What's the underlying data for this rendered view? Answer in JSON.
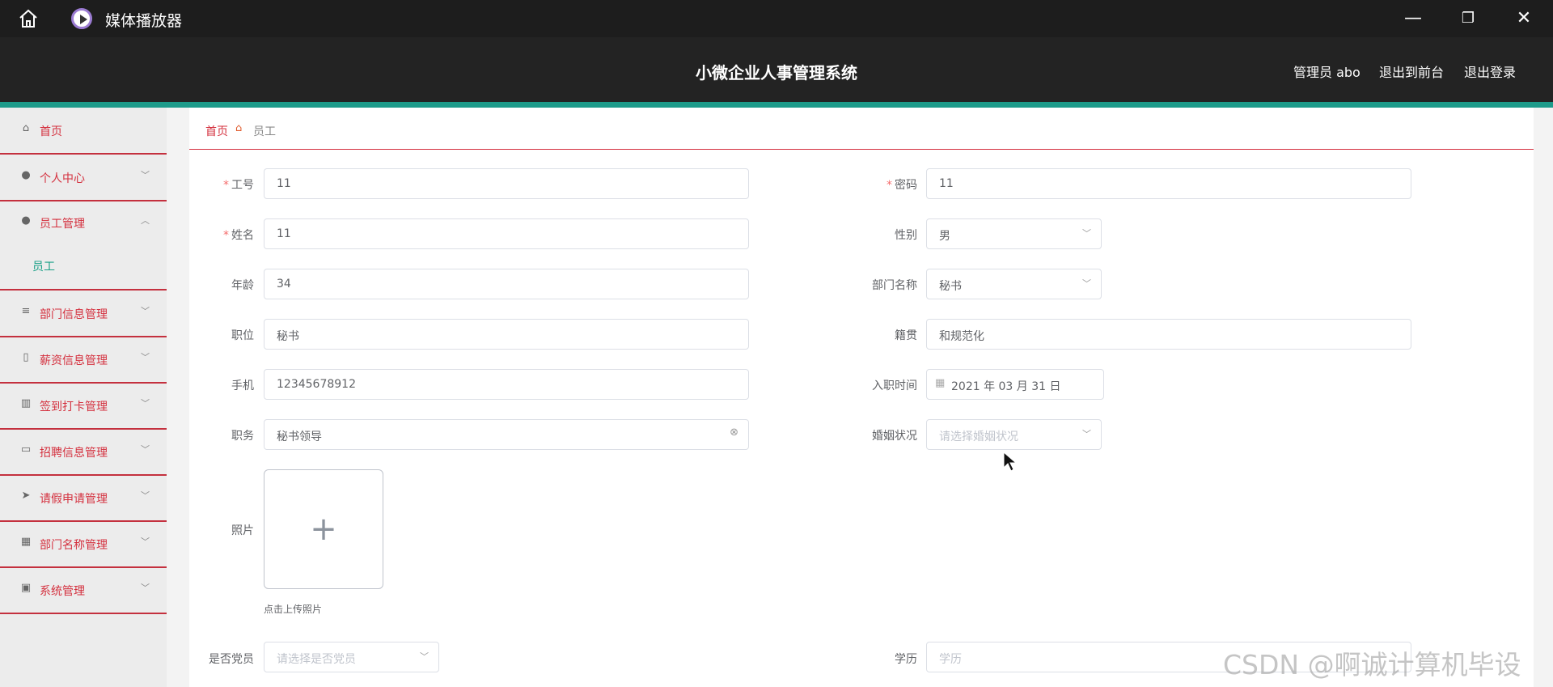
{
  "window": {
    "title": "媒体播放器",
    "controls": [
      "—",
      "❐",
      "✕"
    ]
  },
  "header": {
    "title": "小微企业人事管理系统",
    "links": [
      "管理员 abo",
      "退出到前台",
      "退出登录"
    ],
    "accent_color": "#1d9b8a"
  },
  "sidebar": {
    "items": [
      {
        "label": "首页",
        "icon": "home-icon"
      },
      {
        "label": "个人中心",
        "icon": "user-icon"
      },
      {
        "label": "员工管理",
        "icon": "bulb-icon",
        "sub": [
          "员工"
        ]
      },
      {
        "label": "部门信息管理",
        "icon": "menu-icon"
      },
      {
        "label": "薪资信息管理",
        "icon": "mic-icon"
      },
      {
        "label": "签到打卡管理",
        "icon": "bars-icon"
      },
      {
        "label": "招聘信息管理",
        "icon": "card-icon"
      },
      {
        "label": "请假申请管理",
        "icon": "plane-icon"
      },
      {
        "label": "部门名称管理",
        "icon": "grid-icon"
      },
      {
        "label": "系统管理",
        "icon": "clipboard-icon"
      }
    ]
  },
  "breadcrumb": {
    "home": "首页",
    "current": "员工"
  },
  "form": {
    "gonghao": {
      "label": "工号",
      "value": "11"
    },
    "mima": {
      "label": "密码",
      "value": "11"
    },
    "xingming": {
      "label": "姓名",
      "value": "11"
    },
    "xingbie": {
      "label": "性别",
      "value": "男"
    },
    "nianling": {
      "label": "年龄",
      "value": "34"
    },
    "bumen": {
      "label": "部门名称",
      "value": "秘书"
    },
    "zhiwei": {
      "label": "职位",
      "value": "秘书"
    },
    "jiguan": {
      "label": "籍贯",
      "value": "和规范化"
    },
    "shouji": {
      "label": "手机",
      "value": "12345678912"
    },
    "ruzhi": {
      "label": "入职时间",
      "value": "2021 年 03 月 31 日"
    },
    "zhiwu": {
      "label": "职务",
      "value": "秘书领导"
    },
    "hunyin": {
      "label": "婚姻状况",
      "placeholder": "请选择婚姻状况"
    },
    "zhaopian": {
      "label": "照片",
      "hint": "点击上传照片"
    },
    "dangyuan": {
      "label": "是否党员",
      "placeholder": "请选择是否党员"
    },
    "xueli": {
      "label": "学历",
      "placeholder": "学历"
    }
  },
  "watermark": "CSDN @啊诚计算机毕设"
}
